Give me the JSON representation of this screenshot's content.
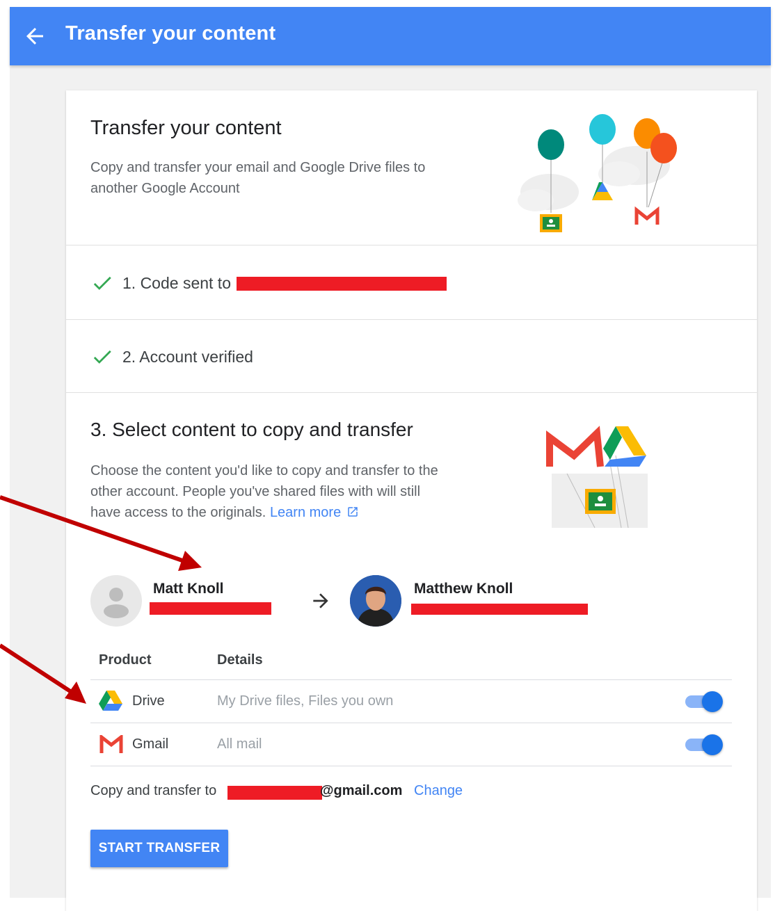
{
  "appbar": {
    "title": "Transfer your content",
    "back_icon": "arrow-back-icon"
  },
  "intro": {
    "title": "Transfer your content",
    "subtitle": "Copy and transfer your email and Google Drive files to another Google Account"
  },
  "steps": [
    {
      "label": "1. Code sent to",
      "icon": "check-icon"
    },
    {
      "label": "2. Account verified",
      "icon": "check-icon"
    }
  ],
  "select": {
    "title": "3. Select content to copy and transfer",
    "description": "Choose the content you'd like to copy and transfer to the other account. People you've shared files with will still have access to the originals.",
    "learn_more": "Learn more"
  },
  "accounts": {
    "source_name": "Matt Knoll",
    "target_name": "Matthew Knoll",
    "arrow_icon": "arrow-forward-icon"
  },
  "table": {
    "headers": [
      "Product",
      "Details"
    ],
    "rows": [
      {
        "product": "Drive",
        "details": "My Drive files, Files you own",
        "enabled": true,
        "icon": "google-drive-icon"
      },
      {
        "product": "Gmail",
        "details": "All mail",
        "enabled": true,
        "icon": "gmail-icon"
      }
    ]
  },
  "copy_to": {
    "label": "Copy and transfer to",
    "email_suffix": "@gmail.com",
    "change": "Change"
  },
  "start_button": "START TRANSFER",
  "colors": {
    "primary": "#4285f4",
    "check": "#34a853",
    "redaction": "#ee1c25",
    "annotation_arrow": "#c00000"
  }
}
